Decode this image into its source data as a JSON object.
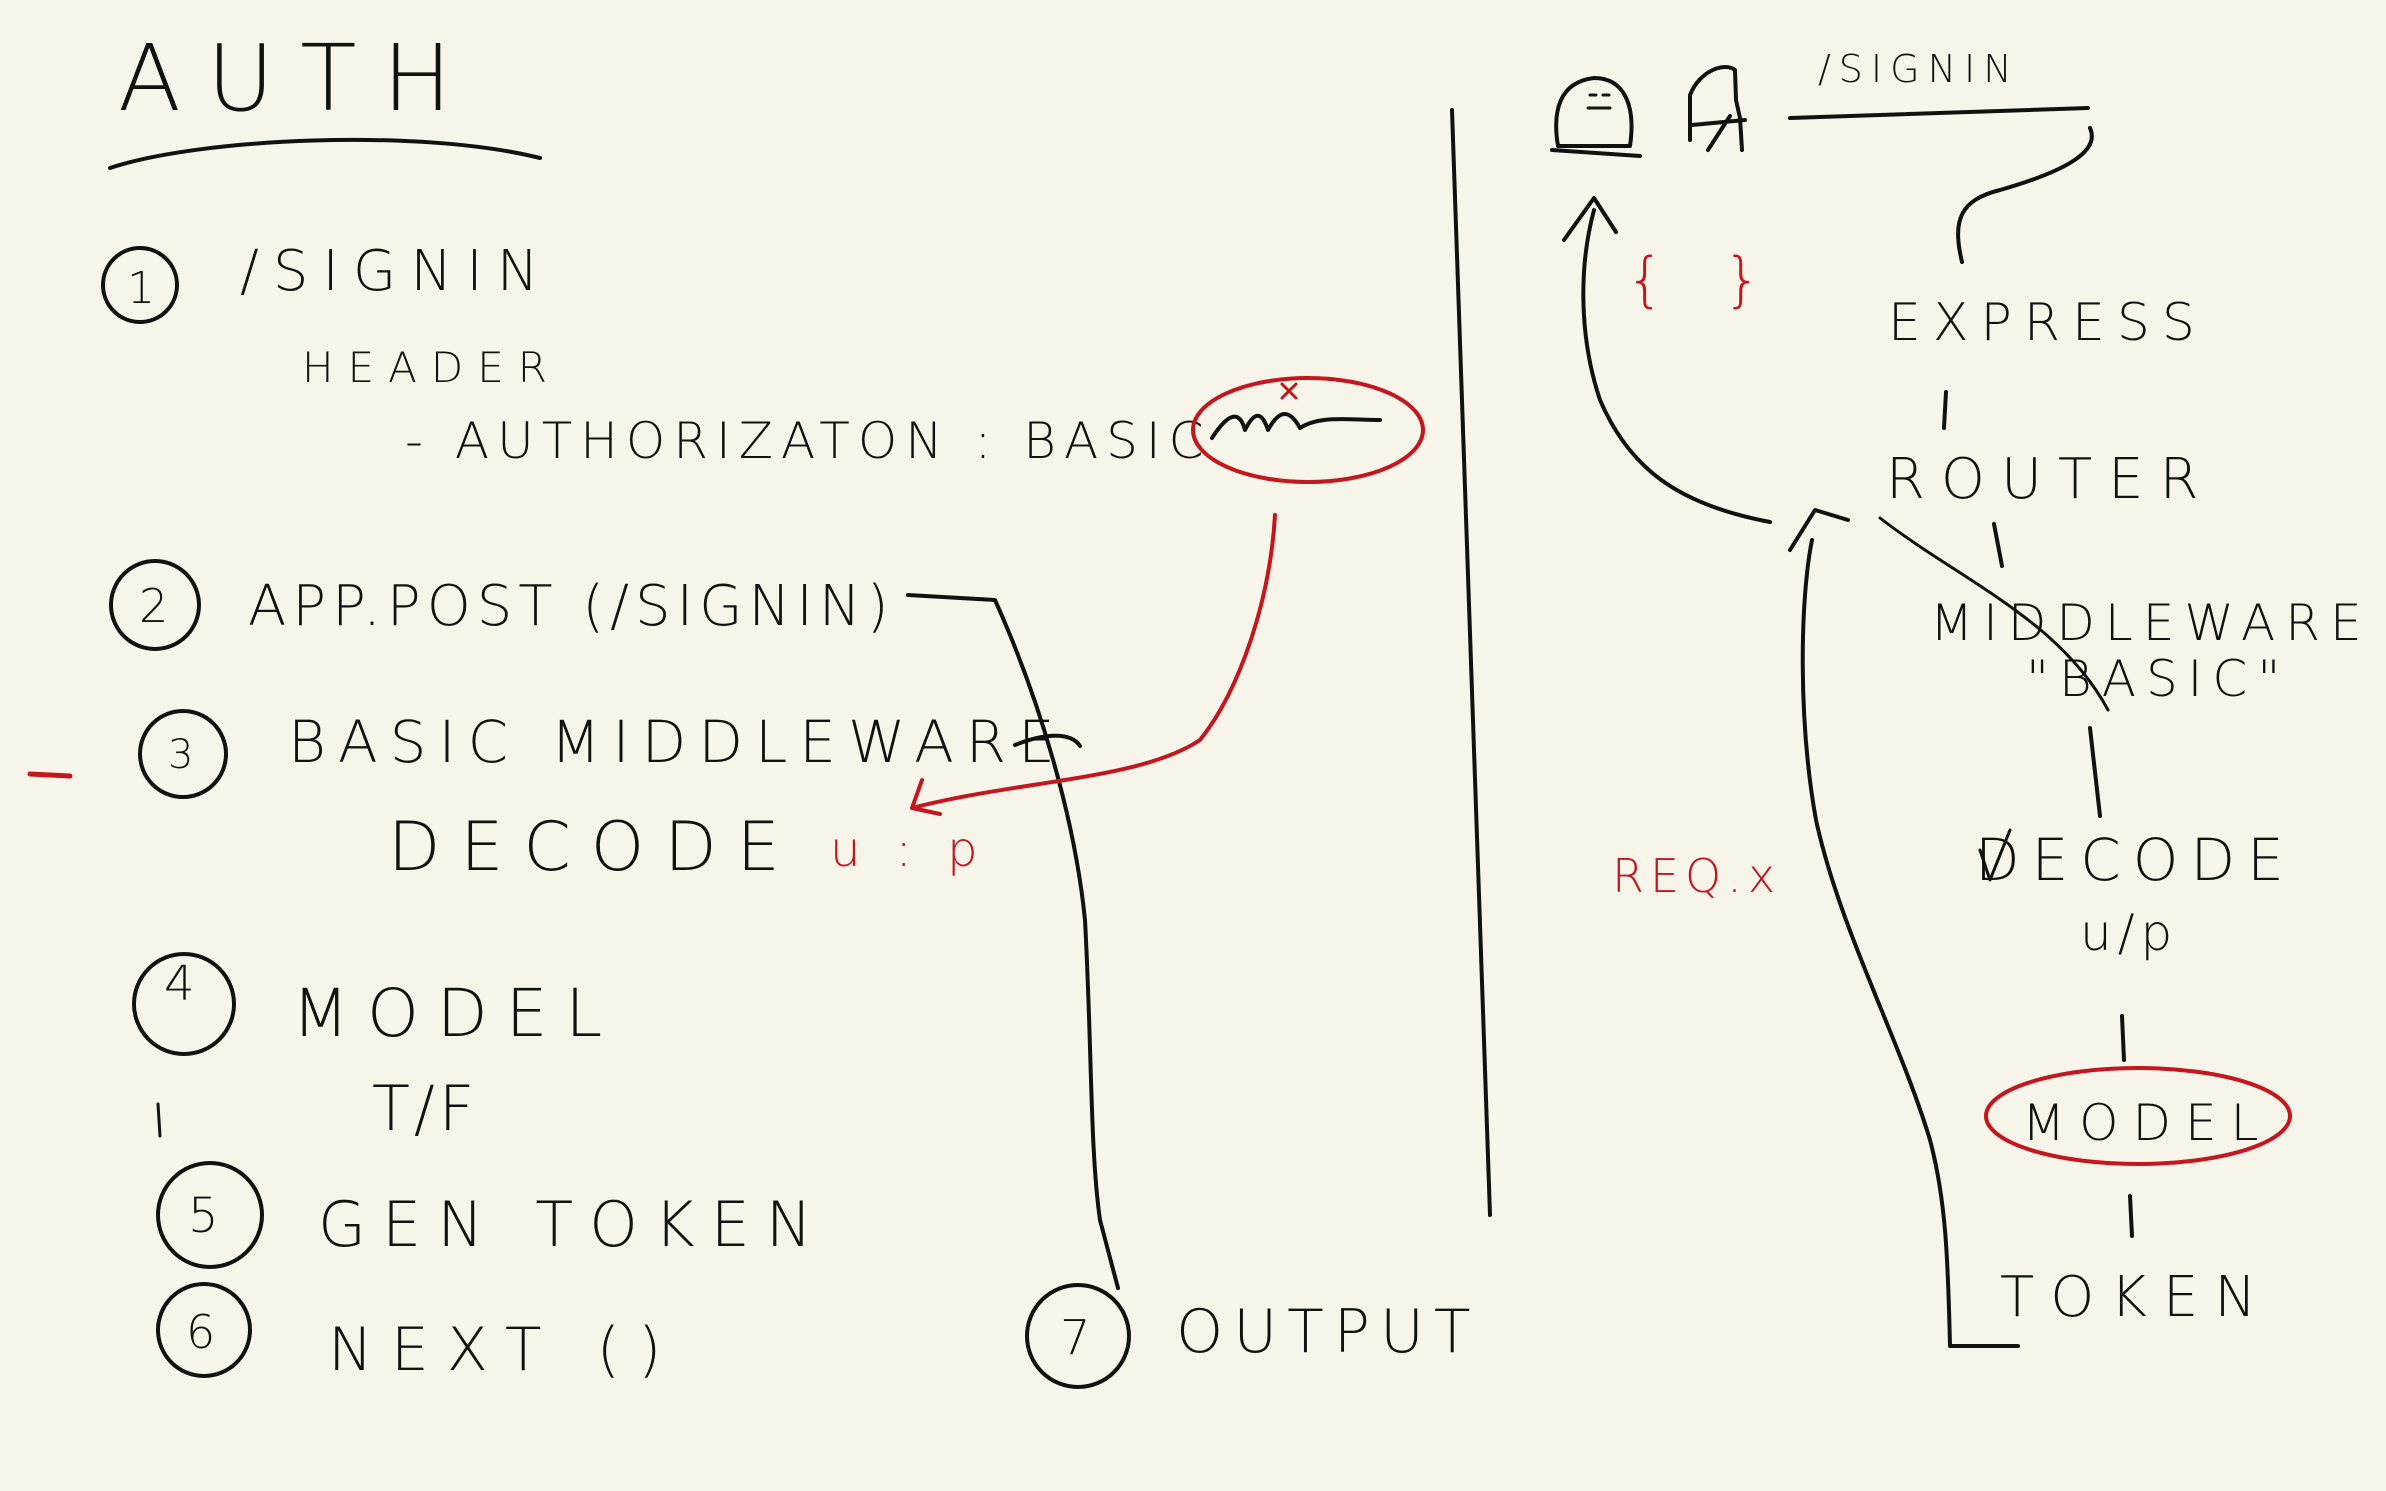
{
  "colors": {
    "background": "#f7f5e9",
    "ink": "#111111",
    "red": "#c4161c"
  },
  "title": "AUTH",
  "steps": [
    {
      "num": "1",
      "label": "/SIGNIN"
    },
    {
      "num": "2",
      "label": "APP.POST (/SIGNIN)"
    },
    {
      "num": "3",
      "label": "BASIC MIDDLEWARE"
    },
    {
      "num": "4",
      "label": "MODEL"
    },
    {
      "num": "5",
      "label": "GEN TOKEN"
    },
    {
      "num": "6",
      "label": "NEXT ()"
    },
    {
      "num": "7",
      "label": "OUTPUT"
    }
  ],
  "notes": {
    "header": "HEADER",
    "authorization": "- AUTHORIZATON : BASIC",
    "decode": "DECODE",
    "decode_red": "u : p",
    "model_result": "T/F"
  },
  "flow": {
    "signin": "/SIGNIN",
    "express": "EXPRESS",
    "router": "ROUTER",
    "middleware": "MIDDLEWARE",
    "basic": "\"BASIC\"",
    "decode": "DECODE",
    "decode_sub": "u/p",
    "model": "MODEL",
    "token": "TOKEN",
    "braces": "{ }",
    "req": "REQ.x"
  },
  "icons": [
    "user-icon",
    "chair-icon"
  ]
}
